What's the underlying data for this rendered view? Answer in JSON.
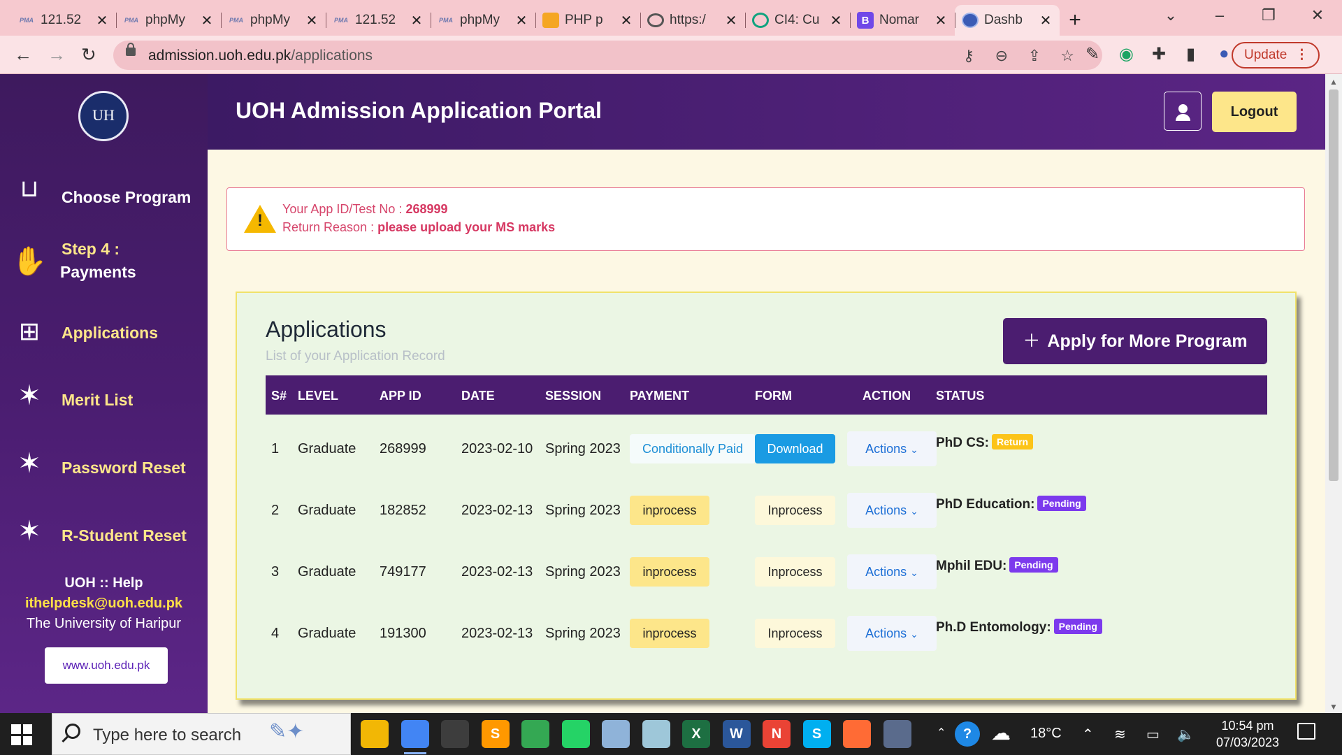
{
  "browser": {
    "tabs": [
      {
        "title": "121.52",
        "favicon": "phpmyadmin-icon",
        "fav_text": "PMA"
      },
      {
        "title": "phpMy",
        "favicon": "phpmyadmin-icon",
        "fav_text": "PMA"
      },
      {
        "title": "phpMy",
        "favicon": "phpmyadmin-icon",
        "fav_text": "PMA"
      },
      {
        "title": "121.52",
        "favicon": "phpmyadmin-icon",
        "fav_text": "PMA"
      },
      {
        "title": "phpMy",
        "favicon": "phpmyadmin-icon",
        "fav_text": "PMA"
      },
      {
        "title": "PHP p",
        "favicon": "php-icon",
        "fav_text": ""
      },
      {
        "title": "https:/",
        "favicon": "globe-icon",
        "fav_text": ""
      },
      {
        "title": "CI4: Cu",
        "favicon": "chatgpt-icon",
        "fav_text": ""
      },
      {
        "title": "Nomar",
        "favicon": "bootstrap-icon",
        "fav_text": "B"
      },
      {
        "title": "Dashb",
        "favicon": "uoh-icon",
        "fav_text": "",
        "active": true
      }
    ],
    "url_host": "admission.uoh.edu.pk",
    "url_path": "/applications",
    "update_label": "Update"
  },
  "sidebar": {
    "logo_text": "UH",
    "items": [
      {
        "label": "Choose Program",
        "icon": "choose-program-icon"
      },
      {
        "label_line1": "Step 4 :",
        "label_line2": "Payments",
        "icon": "payment-hand-icon"
      },
      {
        "label": "Applications",
        "icon": "applications-grid-icon"
      },
      {
        "label": "Merit List",
        "icon": "stars-icon"
      },
      {
        "label": "Password Reset",
        "icon": "stars-icon"
      },
      {
        "label": "R-Student Reset",
        "icon": "stars-icon"
      }
    ],
    "help_title": "UOH :: Help",
    "help_email": "ithelpdesk@uoh.edu.pk",
    "help_org": "The University of Haripur",
    "site_button": "www.uoh.edu.pk"
  },
  "header": {
    "title": "UOH Admission Application Portal",
    "logout_label": "Logout"
  },
  "alert": {
    "app_id_label": "Your App ID/Test No :",
    "app_id_value": "268999",
    "reason_label": "Return Reason :",
    "reason_value": "please upload your MS marks"
  },
  "applications": {
    "title": "Applications",
    "subtitle": "List of your Application Record",
    "apply_button": "Apply for More Program",
    "columns": [
      "S#",
      "LEVEL",
      "APP ID",
      "DATE",
      "SESSION",
      "PAYMENT",
      "FORM",
      "ACTION",
      "STATUS"
    ],
    "rows": [
      {
        "sn": "1",
        "level": "Graduate",
        "app_id": "268999",
        "date": "2023-02-10",
        "session": "Spring 2023",
        "payment": "Conditionally Paid",
        "payment_style": "paid",
        "form": "Download",
        "form_style": "dl",
        "action": "Actions",
        "program": "PhD CS:",
        "status": "Return",
        "status_style": "ret"
      },
      {
        "sn": "2",
        "level": "Graduate",
        "app_id": "182852",
        "date": "2023-02-13",
        "session": "Spring 2023",
        "payment": "inprocess",
        "payment_style": "inproc",
        "form": "Inprocess",
        "form_style": "inproc2",
        "action": "Actions",
        "program": "PhD Education:",
        "status": "Pending",
        "status_style": "pend"
      },
      {
        "sn": "3",
        "level": "Graduate",
        "app_id": "749177",
        "date": "2023-02-13",
        "session": "Spring 2023",
        "payment": "inprocess",
        "payment_style": "inproc",
        "form": "Inprocess",
        "form_style": "inproc2",
        "action": "Actions",
        "program": "Mphil EDU:",
        "status": "Pending",
        "status_style": "pend"
      },
      {
        "sn": "4",
        "level": "Graduate",
        "app_id": "191300",
        "date": "2023-02-13",
        "session": "Spring 2023",
        "payment": "inprocess",
        "payment_style": "inproc",
        "form": "Inprocess",
        "form_style": "inproc2",
        "action": "Actions",
        "program": "Ph.D Entomology:",
        "status": "Pending",
        "status_style": "pend"
      }
    ]
  },
  "taskbar": {
    "search_placeholder": "Type here to search",
    "apps": [
      {
        "name": "file-explorer-icon",
        "color": "#f2b705",
        "glyph": ""
      },
      {
        "name": "chrome-profile-icon",
        "color": "#4285f4",
        "glyph": "",
        "active": true
      },
      {
        "name": "store-lock-icon",
        "color": "#3d3d3d",
        "glyph": ""
      },
      {
        "name": "sublime-text-icon",
        "color": "#ff9800",
        "glyph": "S"
      },
      {
        "name": "chrome-icon",
        "color": "#34a853",
        "glyph": ""
      },
      {
        "name": "whatsapp-icon",
        "color": "#25d366",
        "glyph": ""
      },
      {
        "name": "monitor-app-icon",
        "color": "#8fb3d9",
        "glyph": ""
      },
      {
        "name": "notes-app-icon",
        "color": "#9ec7d9",
        "glyph": ""
      },
      {
        "name": "excel-icon",
        "color": "#1d6f42",
        "glyph": "X"
      },
      {
        "name": "word-icon",
        "color": "#2b579a",
        "glyph": "W"
      },
      {
        "name": "chrome-n-icon",
        "color": "#ea4335",
        "glyph": "N"
      },
      {
        "name": "skype-icon",
        "color": "#00aff0",
        "glyph": "S"
      },
      {
        "name": "brush-app-icon",
        "color": "#ff6b35",
        "glyph": ""
      },
      {
        "name": "calculator-icon",
        "color": "#5a6b8c",
        "glyph": ""
      }
    ],
    "temperature": "18°C",
    "time": "10:54 pm",
    "date": "07/03/2023"
  }
}
